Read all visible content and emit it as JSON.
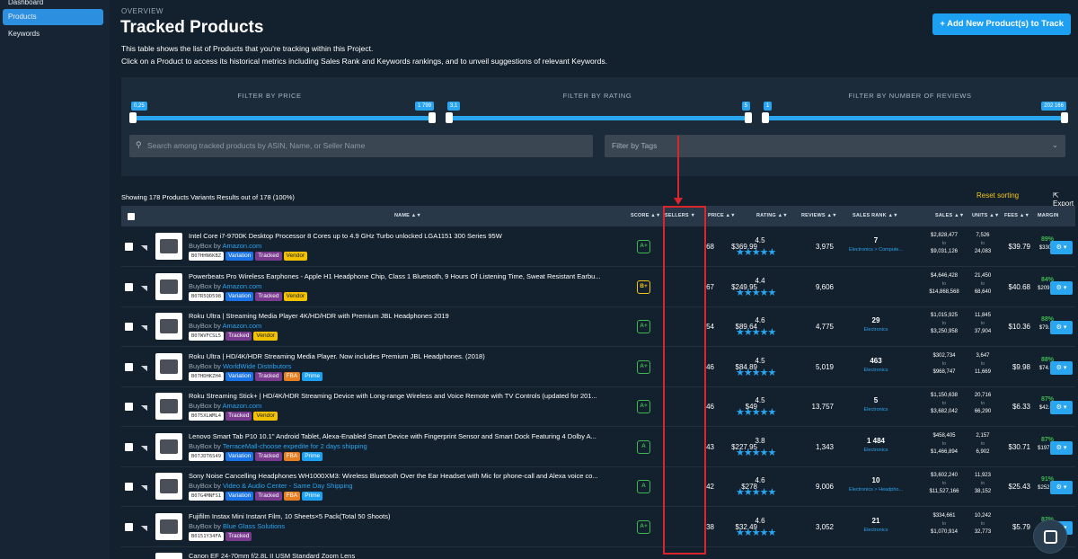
{
  "sidebar": {
    "items": [
      "Dashboard",
      "Products",
      "Keywords"
    ]
  },
  "header": {
    "overview": "OVERVIEW",
    "title": "Tracked Products",
    "desc1": "This table shows the list of Products that you're tracking within this Project.",
    "desc2": "Click on a Product to access its historical metrics including Sales Rank and Keywords rankings, and to unveil suggestions of relevant Keywords.",
    "add_button": "+ Add New Product(s) to Track"
  },
  "filters": {
    "price": {
      "label": "FILTER BY PRICE",
      "min": "0,25",
      "max": "1 799"
    },
    "rating": {
      "label": "FILTER BY RATING",
      "min": "3,1",
      "max": "5"
    },
    "reviews": {
      "label": "FILTER BY NUMBER OF REVIEWS",
      "min": "1",
      "max": "202 166"
    },
    "search_placeholder": "Search among tracked products by ASIN, Name, or Seller Name",
    "tags_placeholder": "Filter by Tags"
  },
  "showing": "Showing 178 Products Variants Results out of 178 (100%)",
  "reset": "Reset sorting",
  "export": "Export List",
  "columns": [
    "NAME",
    "SCORE",
    "SELLERS",
    "PRICE",
    "RATING",
    "REVIEWS",
    "SALES RANK",
    "SALES",
    "UNITS",
    "FEES",
    "MARGIN"
  ],
  "rows": [
    {
      "name": "Intel Core i7-9700K Desktop Processor 8 Cores up to 4.9 GHz Turbo unlocked LGA1151 300 Series 95W",
      "seller": "Amazon.com",
      "asin": "B07HHN6KBZ",
      "badges": [
        "Variation",
        "Tracked",
        "Vendor"
      ],
      "score": "A+",
      "sellers": "68",
      "price": "$369.99",
      "rating": "4.5",
      "reviews": "3,975",
      "rank": "7",
      "cat": "Electronics > Compute...",
      "sales_lo": "$2,828,477",
      "sales_hi": "$9,031,126",
      "units_lo": "7,526",
      "units_hi": "24,083",
      "fees": "$39.79",
      "margin_p": "89%",
      "margin_v": "$330.2"
    },
    {
      "name": "Powerbeats Pro Wireless Earphones - Apple H1 Headphone Chip, Class 1 Bluetooth, 9 Hours Of Listening Time, Sweat Resistant Earbu...",
      "seller": "Amazon.com",
      "asin": "B07R5QD598",
      "badges": [
        "Variation",
        "Tracked",
        "Vendor"
      ],
      "score": "B+",
      "sellers": "67",
      "price": "$249.95",
      "rating": "4.4",
      "reviews": "9,606",
      "rank": "",
      "cat": "",
      "sales_lo": "$4,646,428",
      "sales_hi": "$14,868,568",
      "units_lo": "21,450",
      "units_hi": "68,640",
      "fees": "$40.68",
      "margin_p": "84%",
      "margin_v": "$209.27"
    },
    {
      "name": "Roku Ultra | Streaming Media Player 4K/HD/HDR with Premium JBL Headphones 2019",
      "seller": "Amazon.com",
      "asin": "B07WVFCSL5",
      "badges": [
        "Tracked",
        "Vendor"
      ],
      "score": "A+",
      "sellers": "54",
      "price": "$89.64",
      "rating": "4.6",
      "reviews": "4,775",
      "rank": "29",
      "cat": "Electronics",
      "sales_lo": "$1,015,925",
      "sales_hi": "$3,250,958",
      "units_lo": "11,845",
      "units_hi": "37,904",
      "fees": "$10.36",
      "margin_p": "88%",
      "margin_v": "$79.28"
    },
    {
      "name": "Roku Ultra | HD/4K/HDR Streaming Media Player. Now includes Premium JBL Headphones. (2018)",
      "seller": "WorldWide Distributors",
      "asin": "B07HDHKZH4",
      "badges": [
        "Variation",
        "Tracked",
        "FBA",
        "Prime"
      ],
      "score": "A+",
      "sellers": "46",
      "price": "$84.89",
      "rating": "4.5",
      "reviews": "5,019",
      "rank": "463",
      "cat": "Electronics",
      "sales_lo": "$302,734",
      "sales_hi": "$968,747",
      "units_lo": "3,647",
      "units_hi": "11,669",
      "fees": "$9.98",
      "margin_p": "88%",
      "margin_v": "$74.91"
    },
    {
      "name": "Roku Streaming Stick+ | HD/4K/HDR Streaming Device with Long-range Wireless and Voice Remote with TV Controls (updated for 201...",
      "seller": "Amazon.com",
      "asin": "B075XLWML4",
      "badges": [
        "Tracked",
        "Vendor"
      ],
      "score": "A+",
      "sellers": "46",
      "price": "$49",
      "rating": "4.5",
      "reviews": "13,757",
      "rank": "5",
      "cat": "Electronics",
      "sales_lo": "$1,150,638",
      "sales_hi": "$3,682,042",
      "units_lo": "20,716",
      "units_hi": "66,290",
      "fees": "$6.33",
      "margin_p": "87%",
      "margin_v": "$42.67"
    },
    {
      "name": "Lenovo Smart Tab P10 10.1\" Android Tablet, Alexa-Enabled Smart Device with Fingerprint Sensor and Smart Dock Featuring 4 Dolby A...",
      "seller": "TerraceMall-choose expedite for 2 days shipping",
      "asin": "B07JDT6S49",
      "badges": [
        "Variation",
        "Tracked",
        "FBA",
        "Prime"
      ],
      "score": "A",
      "sellers": "43",
      "price": "$227.95",
      "rating": "3.8",
      "reviews": "1,343",
      "rank": "1 484",
      "cat": "Electronics",
      "sales_lo": "$458,405",
      "sales_hi": "$1,466,894",
      "units_lo": "2,157",
      "units_hi": "6,902",
      "fees": "$30.71",
      "margin_p": "87%",
      "margin_v": "$197.24"
    },
    {
      "name": "Sony Noise Cancelling Headphones WH1000XM3: Wireless Bluetooth Over the Ear Headset with Mic for phone-call and Alexa voice co...",
      "seller": "Video & Audio Center - Same Day Shipping",
      "asin": "B07G4MNFS1",
      "badges": [
        "Variation",
        "Tracked",
        "FBA",
        "Prime"
      ],
      "score": "A",
      "sellers": "42",
      "price": "$278",
      "rating": "4.6",
      "reviews": "9,006",
      "rank": "10",
      "cat": "Electronics > Headpho...",
      "sales_lo": "$3,602,240",
      "sales_hi": "$11,527,166",
      "units_lo": "11,923",
      "units_hi": "38,152",
      "fees": "$25.43",
      "margin_p": "91%",
      "margin_v": "$252.57"
    },
    {
      "name": "Fujifilm Instax Mini Instant Film, 10 Sheets×5 Pack(Total 50 Shoots)",
      "seller": "Blue Glass Solutions",
      "asin": "B0151Y34FA",
      "badges": [
        "Tracked"
      ],
      "score": "A+",
      "sellers": "38",
      "price": "$32.49",
      "rating": "4.6",
      "reviews": "3,052",
      "rank": "21",
      "cat": "Electronics",
      "sales_lo": "$334,661",
      "sales_hi": "$1,070,914",
      "units_lo": "10,242",
      "units_hi": "32,773",
      "fees": "$5.79",
      "margin_p": "82%",
      "margin_v": "$26.7"
    },
    {
      "name": "Canon EF 24-70mm f/2.8L II USM Standard Zoom Lens",
      "seller": "",
      "asin": "",
      "badges": [],
      "score": "",
      "sellers": "",
      "price": "",
      "rating": "",
      "reviews": "",
      "rank": "",
      "cat": "",
      "sales_lo": "",
      "sales_hi": "",
      "units_lo": "",
      "units_hi": "",
      "fees": "",
      "margin_p": "",
      "margin_v": ""
    }
  ],
  "buybox_label": "BuyBox by",
  "to": "to"
}
